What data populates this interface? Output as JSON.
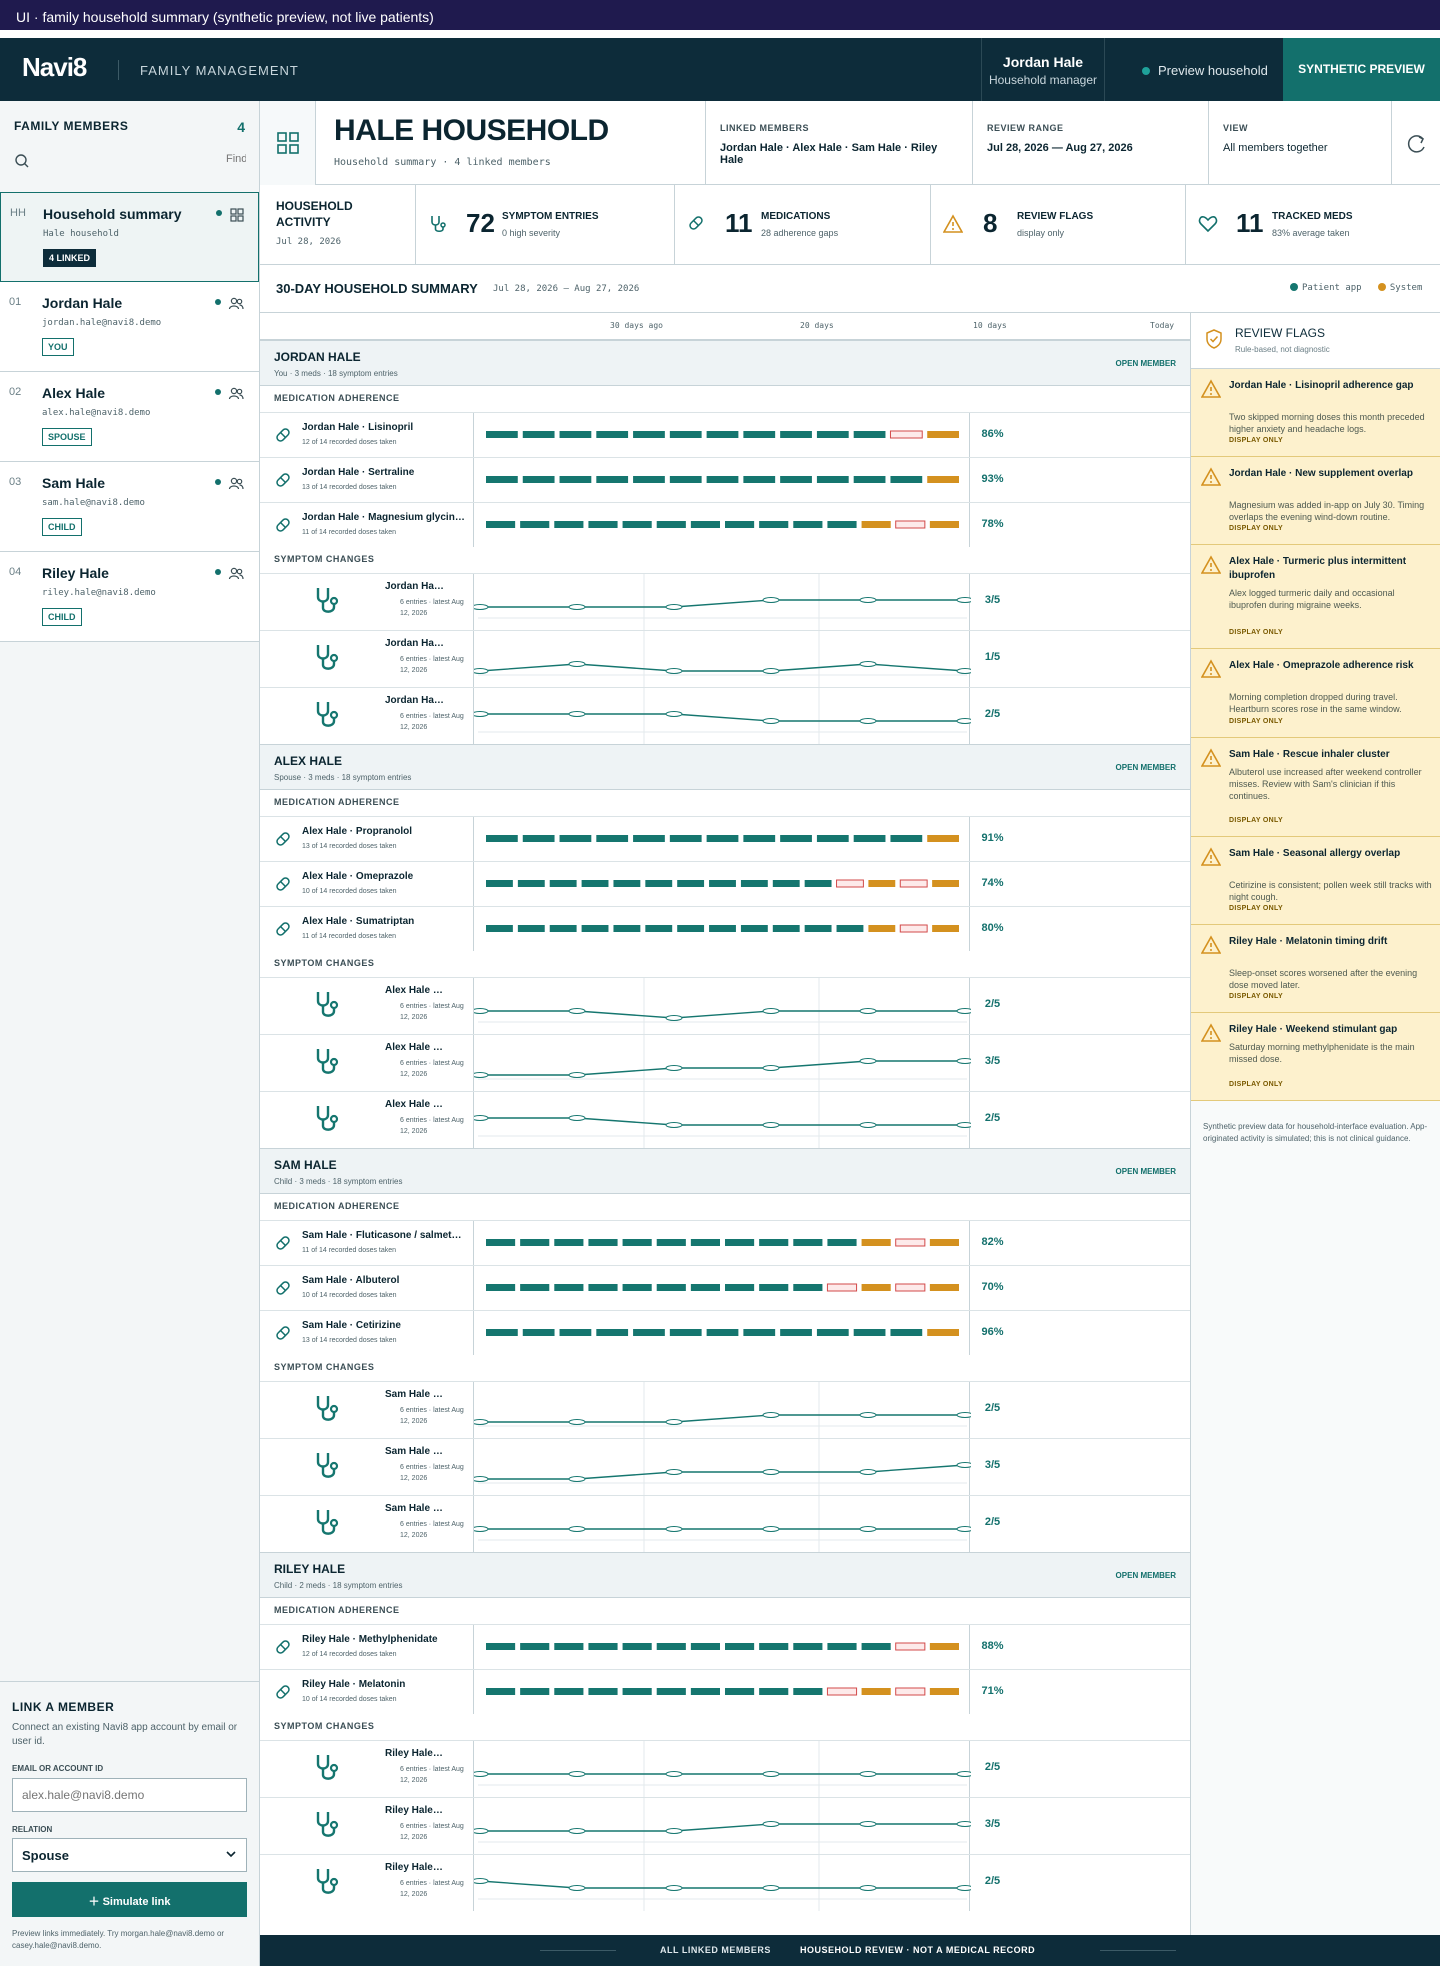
{
  "window_title": "UI · family household summary (synthetic preview, not live patients)",
  "header": {
    "logo": "Navi8",
    "section": "FAMILY MANAGEMENT",
    "user_name": "Jordan Hale",
    "user_role": "Household manager",
    "preview_label": "Preview household",
    "synthetic_label": "SYNTHETIC PREVIEW"
  },
  "sidebar": {
    "title": "FAMILY MEMBERS",
    "count": "4",
    "search_placeholder": "Find",
    "members": [
      {
        "idx": "HH",
        "name": "Household summary",
        "sub": "Hale household",
        "badge": "4 LINKED"
      },
      {
        "idx": "01",
        "name": "Jordan Hale",
        "sub": "jordan.hale@navi8.demo",
        "badge": "YOU"
      },
      {
        "idx": "02",
        "name": "Alex Hale",
        "sub": "alex.hale@navi8.demo",
        "badge": "SPOUSE"
      },
      {
        "idx": "03",
        "name": "Sam Hale",
        "sub": "sam.hale@navi8.demo",
        "badge": "CHILD"
      },
      {
        "idx": "04",
        "name": "Riley Hale",
        "sub": "riley.hale@navi8.demo",
        "badge": "CHILD"
      }
    ],
    "link": {
      "title": "LINK A MEMBER",
      "desc": "Connect an existing Navi8 app account by email or user id.",
      "email_label": "EMAIL OR ACCOUNT ID",
      "email_placeholder": "alex.hale@navi8.demo",
      "relation_label": "RELATION",
      "relation_value": "Spouse",
      "button": "Simulate link",
      "note": "Preview links immediately. Try morgan.hale@navi8.demo or casey.hale@navi8.demo."
    }
  },
  "household": {
    "title": "HALE HOUSEHOLD",
    "subtitle": "Household summary · 4 linked members",
    "linked_label": "LINKED MEMBERS",
    "linked_value": "Jordan Hale · Alex Hale · Sam Hale · Riley Hale",
    "range_label": "REVIEW RANGE",
    "range_value": "Jul 28, 2026 — Aug 27, 2026",
    "view_label": "VIEW",
    "view_value": "All members together"
  },
  "activity": {
    "title": "HOUSEHOLD ACTIVITY",
    "date": "Jul 28, 2026",
    "stats": [
      {
        "icon": "stethoscope-icon",
        "num": "72",
        "label": "SYMPTOM ENTRIES",
        "sub": "0 high severity"
      },
      {
        "icon": "pill-icon",
        "num": "11",
        "label": "MEDICATIONS",
        "sub": "28 adherence gaps"
      },
      {
        "icon": "warning-icon",
        "num": "8",
        "label": "REVIEW FLAGS",
        "sub": "display only"
      },
      {
        "icon": "heart-icon",
        "num": "11",
        "label": "TRACKED MEDS",
        "sub": "83% average taken"
      }
    ]
  },
  "summary": {
    "title": "30-DAY HOUSEHOLD SUMMARY",
    "range": "Jul 28, 2026 – Aug 27, 2026",
    "legend_app": "Patient app",
    "legend_system": "System",
    "axis": [
      "30 days ago",
      "20 days",
      "10 days",
      "Today"
    ],
    "med_group_label": "MEDICATION ADHERENCE",
    "sym_group_label": "SYMPTOM CHANGES",
    "open_label": "OPEN MEMBER"
  },
  "colors": {
    "taken": "#15766f",
    "late": "#d4911f",
    "missed_fill": "#fdeaea",
    "missed_border": "#d24a4a",
    "accent": "#13706c",
    "flag_bg": "#fdf1cd"
  },
  "legend_codes": "bars: t=taken (teal), l=late (amber), m=missed (red outline)",
  "members": [
    {
      "name": "JORDAN HALE",
      "sub": "You · 3 meds · 18 symptom entries",
      "meds": [
        {
          "name": "Jordan Hale · Lisinopril",
          "sub": "12 of 14 recorded doses taken",
          "pct": "86%",
          "bars": "tttttttttttml"
        },
        {
          "name": "Jordan Hale · Sertraline",
          "sub": "13 of 14 recorded doses taken",
          "pct": "93%",
          "bars": "ttttttttttttl"
        },
        {
          "name": "Jordan Hale · Magnesium glycinate",
          "sub": "11 of 14 recorded doses taken",
          "pct": "78%",
          "bars": "tttttttttttlml"
        }
      ],
      "symptoms": [
        {
          "name": "Jordan Hale · Sleep",
          "sub": "6 entries · latest Aug 12, 2026",
          "score": "3/5",
          "values": [
            2,
            2,
            2,
            3,
            3,
            3
          ]
        },
        {
          "name": "Jordan Hale · Anxiety",
          "sub": "6 entries · latest Aug 12, 2026",
          "score": "1/5",
          "values": [
            1,
            2,
            1,
            1,
            2,
            1
          ]
        },
        {
          "name": "Jordan Hale · Headache",
          "sub": "6 entries · latest Aug 12, 2026",
          "score": "2/5",
          "values": [
            3,
            3,
            3,
            2,
            2,
            2
          ]
        }
      ]
    },
    {
      "name": "ALEX HALE",
      "sub": "Spouse · 3 meds · 18 symptom entries",
      "meds": [
        {
          "name": "Alex Hale · Propranolol",
          "sub": "13 of 14 recorded doses taken",
          "pct": "91%",
          "bars": "ttttttttttttl"
        },
        {
          "name": "Alex Hale · Omeprazole",
          "sub": "10 of 14 recorded doses taken",
          "pct": "74%",
          "bars": "tttttttttttmlml"
        },
        {
          "name": "Alex Hale · Sumatriptan",
          "sub": "11 of 14 recorded doses taken",
          "pct": "80%",
          "bars": "ttttttttttttlml"
        }
      ],
      "symptoms": [
        {
          "name": "Alex Hale · Migraine",
          "sub": "6 entries · latest Aug 12, 2026",
          "score": "2/5",
          "values": [
            2,
            2,
            1,
            2,
            2,
            2
          ]
        },
        {
          "name": "Alex Hale · Heartburn",
          "sub": "6 entries · latest Aug 12, 2026",
          "score": "3/5",
          "values": [
            1,
            1,
            2,
            2,
            3,
            3
          ]
        },
        {
          "name": "Alex Hale · Fatigue",
          "sub": "6 entries · latest Aug 12, 2026",
          "score": "2/5",
          "values": [
            3,
            3,
            2,
            2,
            2,
            2
          ]
        }
      ]
    },
    {
      "name": "SAM HALE",
      "sub": "Child · 3 meds · 18 symptom entries",
      "meds": [
        {
          "name": "Sam Hale · Fluticasone / salmeterol",
          "sub": "11 of 14 recorded doses taken",
          "pct": "82%",
          "bars": "tttttttttttlml"
        },
        {
          "name": "Sam Hale · Albuterol",
          "sub": "10 of 14 recorded doses taken",
          "pct": "70%",
          "bars": "ttttttttttmlml"
        },
        {
          "name": "Sam Hale · Cetirizine",
          "sub": "13 of 14 recorded doses taken",
          "pct": "96%",
          "bars": "ttttttttttttl"
        }
      ],
      "symptoms": [
        {
          "name": "Sam Hale · Cough",
          "sub": "6 entries · latest Aug 12, 2026",
          "score": "2/5",
          "values": [
            1,
            1,
            1,
            2,
            2,
            2
          ]
        },
        {
          "name": "Sam Hale · Wheeze",
          "sub": "6 entries · latest Aug 12, 2026",
          "score": "3/5",
          "values": [
            1,
            1,
            2,
            2,
            2,
            3
          ]
        },
        {
          "name": "Sam Hale · Allergy",
          "sub": "6 entries · latest Aug 12, 2026",
          "score": "2/5",
          "values": [
            2,
            2,
            2,
            2,
            2,
            2
          ]
        }
      ]
    },
    {
      "name": "RILEY HALE",
      "sub": "Child · 2 meds · 18 symptom entries",
      "meds": [
        {
          "name": "Riley Hale · Methylphenidate",
          "sub": "12 of 14 recorded doses taken",
          "pct": "88%",
          "bars": "ttttttttttttml"
        },
        {
          "name": "Riley Hale · Melatonin",
          "sub": "10 of 14 recorded doses taken",
          "pct": "71%",
          "bars": "ttttttttttmlml"
        }
      ],
      "symptoms": [
        {
          "name": "Riley Hale · Sleep onset",
          "sub": "6 entries · latest Aug 12, 2026",
          "score": "2/5",
          "values": [
            2,
            2,
            2,
            2,
            2,
            2
          ]
        },
        {
          "name": "Riley Hale · Focus",
          "sub": "6 entries · latest Aug 12, 2026",
          "score": "3/5",
          "values": [
            2,
            2,
            2,
            3,
            3,
            3
          ]
        },
        {
          "name": "Riley Hale · Appetite",
          "sub": "6 entries · latest Aug 12, 2026",
          "score": "2/5",
          "values": [
            3,
            2,
            2,
            2,
            2,
            2
          ]
        }
      ]
    }
  ],
  "flags": {
    "title": "REVIEW FLAGS",
    "subtitle": "Rule-based, not diagnostic",
    "display_label": "DISPLAY ONLY",
    "items": [
      {
        "title": "Jordan Hale · Lisinopril adherence gap",
        "desc": "Two skipped morning doses this month preceded higher anxiety and headache logs."
      },
      {
        "title": "Jordan Hale · New supplement overlap",
        "desc": "Magnesium was added in-app on July 30. Timing overlaps the evening wind-down routine."
      },
      {
        "title": "Alex Hale · Turmeric plus intermittent ibuprofen",
        "desc": "Alex logged turmeric daily and occasional ibuprofen during migraine weeks."
      },
      {
        "title": "Alex Hale · Omeprazole adherence risk",
        "desc": "Morning completion dropped during travel. Heartburn scores rose in the same window."
      },
      {
        "title": "Sam Hale · Rescue inhaler cluster",
        "desc": "Albuterol use increased after weekend controller misses. Review with Sam's clinician if this continues."
      },
      {
        "title": "Sam Hale · Seasonal allergy overlap",
        "desc": "Cetirizine is consistent; pollen week still tracks with night cough."
      },
      {
        "title": "Riley Hale · Melatonin timing drift",
        "desc": "Sleep-onset scores worsened after the evening dose moved later."
      },
      {
        "title": "Riley Hale · Weekend stimulant gap",
        "desc": "Saturday morning methylphenidate is the main missed dose."
      }
    ],
    "note": "Synthetic preview data for household-interface evaluation. App-originated activity is simulated; this is not clinical guidance."
  },
  "footer": {
    "left": "ALL LINKED MEMBERS",
    "right": "HOUSEHOLD REVIEW · NOT A MEDICAL RECORD"
  }
}
